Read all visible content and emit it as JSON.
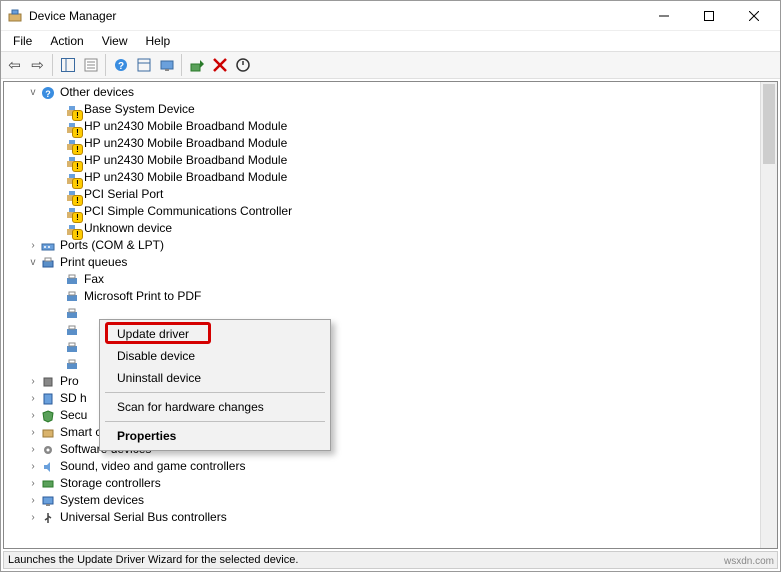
{
  "window": {
    "title": "Device Manager"
  },
  "menus": {
    "file": "File",
    "action": "Action",
    "view": "View",
    "help": "Help"
  },
  "tree": {
    "other_devices": {
      "label": "Other devices",
      "items": [
        "Base System Device",
        "HP un2430 Mobile Broadband Module",
        "HP un2430 Mobile Broadband Module",
        "HP un2430 Mobile Broadband Module",
        "HP un2430 Mobile Broadband Module",
        "PCI Serial Port",
        "PCI Simple Communications Controller",
        "Unknown device"
      ]
    },
    "ports": {
      "label": "Ports (COM & LPT)"
    },
    "print_queues": {
      "label": "Print queues",
      "items": [
        "Fax",
        "Microsoft Print to PDF",
        "",
        "",
        "",
        ""
      ]
    },
    "processors": {
      "label": "Pro"
    },
    "sd_host": {
      "label": "SD h"
    },
    "security": {
      "label": "Secu"
    },
    "smart_card": {
      "label": "Smart card readers"
    },
    "software": {
      "label": "Software devices"
    },
    "sound": {
      "label": "Sound, video and game controllers"
    },
    "storage": {
      "label": "Storage controllers"
    },
    "system": {
      "label": "System devices"
    },
    "usb": {
      "label": "Universal Serial Bus controllers"
    }
  },
  "context_menu": {
    "update": "Update driver",
    "disable": "Disable device",
    "uninstall": "Uninstall device",
    "scan": "Scan for hardware changes",
    "properties": "Properties"
  },
  "statusbar": {
    "text": "Launches the Update Driver Wizard for the selected device."
  },
  "watermark": "wsxdn.com"
}
